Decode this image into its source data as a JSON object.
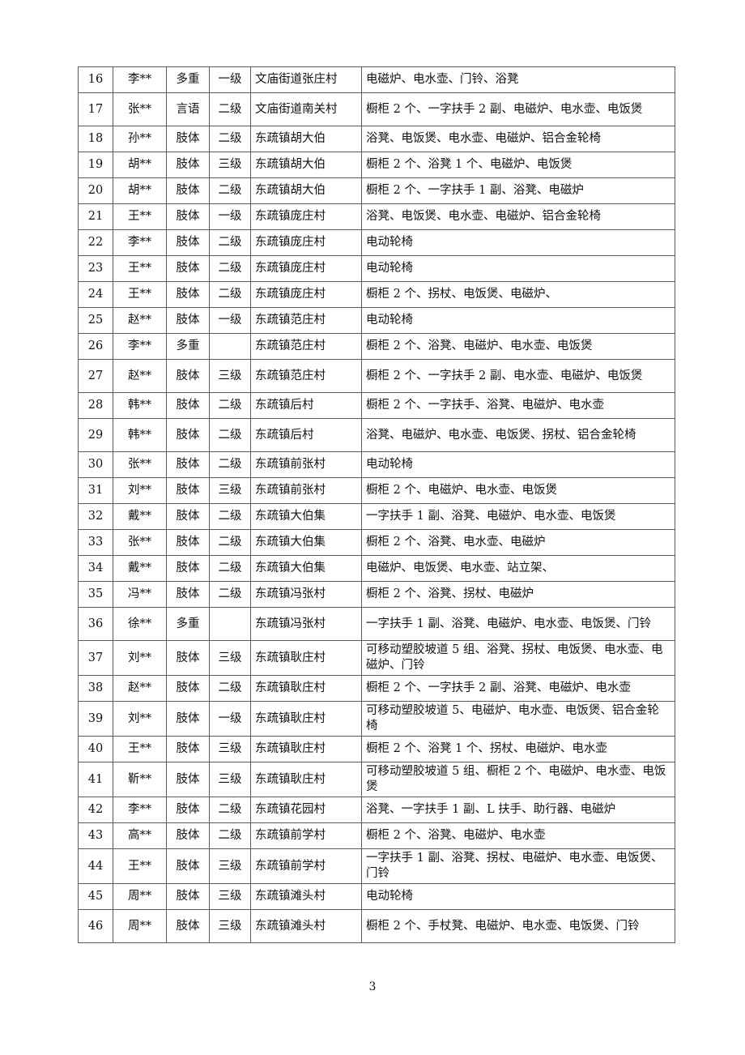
{
  "table": {
    "rows": [
      {
        "no": "16",
        "name": "李**",
        "type": "多重",
        "level": "一级",
        "address": "文庙街道张庄村",
        "items": "电磁炉、电水壶、门铃、浴凳"
      },
      {
        "no": "17",
        "name": "张**",
        "type": "言语",
        "level": "二级",
        "address": "文庙街道南关村",
        "items": "橱柜 2 个、一字扶手 2 副、电磁炉、电水壶、电饭煲"
      },
      {
        "no": "18",
        "name": "孙**",
        "type": "肢体",
        "level": "二级",
        "address": "东疏镇胡大伯",
        "items": "浴凳、电饭煲、电水壶、电磁炉、铝合金轮椅"
      },
      {
        "no": "19",
        "name": "胡**",
        "type": "肢体",
        "level": "三级",
        "address": "东疏镇胡大伯",
        "items": "橱柜 2 个、浴凳 1 个、电磁炉、电饭煲"
      },
      {
        "no": "20",
        "name": "胡**",
        "type": "肢体",
        "level": "二级",
        "address": "东疏镇胡大伯",
        "items": "橱柜 2 个、一字扶手 1 副、浴凳、电磁炉"
      },
      {
        "no": "21",
        "name": "王**",
        "type": "肢体",
        "level": "一级",
        "address": "东疏镇庞庄村",
        "items": "浴凳、电饭煲、电水壶、电磁炉、铝合金轮椅"
      },
      {
        "no": "22",
        "name": "李**",
        "type": "肢体",
        "level": "二级",
        "address": "东疏镇庞庄村",
        "items": "电动轮椅"
      },
      {
        "no": "23",
        "name": "王**",
        "type": "肢体",
        "level": "二级",
        "address": "东疏镇庞庄村",
        "items": "电动轮椅"
      },
      {
        "no": "24",
        "name": "王**",
        "type": "肢体",
        "level": "二级",
        "address": "东疏镇庞庄村",
        "items": "橱柜 2 个、拐杖、电饭煲、电磁炉、"
      },
      {
        "no": "25",
        "name": "赵**",
        "type": "肢体",
        "level": "一级",
        "address": "东疏镇范庄村",
        "items": "电动轮椅"
      },
      {
        "no": "26",
        "name": "李**",
        "type": "多重",
        "level": "",
        "address": "东疏镇范庄村",
        "items": "橱柜 2 个、浴凳、电磁炉、电水壶、电饭煲"
      },
      {
        "no": "27",
        "name": "赵**",
        "type": "肢体",
        "level": "三级",
        "address": "东疏镇范庄村",
        "items": "橱柜 2 个、一字扶手 2 副、电水壶、电磁炉、电饭煲"
      },
      {
        "no": "28",
        "name": "韩**",
        "type": "肢体",
        "level": "二级",
        "address": "东疏镇后村",
        "items": "橱柜 2 个、一字扶手、浴凳、电磁炉、电水壶"
      },
      {
        "no": "29",
        "name": "韩**",
        "type": "肢体",
        "level": "二级",
        "address": "东疏镇后村",
        "items": "浴凳、电磁炉、电水壶、电饭煲、拐杖、铝合金轮椅"
      },
      {
        "no": "30",
        "name": "张**",
        "type": "肢体",
        "level": "二级",
        "address": "东疏镇前张村",
        "items": "电动轮椅"
      },
      {
        "no": "31",
        "name": "刘**",
        "type": "肢体",
        "level": "三级",
        "address": "东疏镇前张村",
        "items": "橱柜 2 个、电磁炉、电水壶、电饭煲"
      },
      {
        "no": "32",
        "name": "戴**",
        "type": "肢体",
        "level": "二级",
        "address": "东疏镇大伯集",
        "items": "一字扶手 1 副、浴凳、电磁炉、电水壶、电饭煲"
      },
      {
        "no": "33",
        "name": "张**",
        "type": "肢体",
        "level": "二级",
        "address": "东疏镇大伯集",
        "items": "橱柜 2 个、浴凳、电水壶、电磁炉"
      },
      {
        "no": "34",
        "name": "戴**",
        "type": "肢体",
        "level": "二级",
        "address": "东疏镇大伯集",
        "items": "电磁炉、电饭煲、电水壶、站立架、"
      },
      {
        "no": "35",
        "name": "冯**",
        "type": "肢体",
        "level": "二级",
        "address": "东疏镇冯张村",
        "items": "橱柜 2 个、浴凳、拐杖、电磁炉"
      },
      {
        "no": "36",
        "name": "徐**",
        "type": "多重",
        "level": "",
        "address": "东疏镇冯张村",
        "items": "一字扶手 1 副、浴凳、电磁炉、电水壶、电饭煲、门铃"
      },
      {
        "no": "37",
        "name": "刘**",
        "type": "肢体",
        "level": "三级",
        "address": "东疏镇耿庄村",
        "items": "可移动塑胶坡道 5 组、浴凳、拐杖、电饭煲、电水壶、电磁炉、门铃"
      },
      {
        "no": "38",
        "name": "赵**",
        "type": "肢体",
        "level": "二级",
        "address": "东疏镇耿庄村",
        "items": "橱柜 2 个、一字扶手 2 副、浴凳、电磁炉、电水壶"
      },
      {
        "no": "39",
        "name": "刘**",
        "type": "肢体",
        "level": "一级",
        "address": "东疏镇耿庄村",
        "items": "可移动塑胶坡道 5、电磁炉、电水壶、电饭煲、铝合金轮椅"
      },
      {
        "no": "40",
        "name": "王**",
        "type": "肢体",
        "level": "三级",
        "address": "东疏镇耿庄村",
        "items": "橱柜 2 个、浴凳 1 个、拐杖、电磁炉、电水壶"
      },
      {
        "no": "41",
        "name": "靳**",
        "type": "肢体",
        "level": "三级",
        "address": "东疏镇耿庄村",
        "items": "可移动塑胶坡道 5 组、橱柜 2 个、电磁炉、电水壶、电饭煲"
      },
      {
        "no": "42",
        "name": "李**",
        "type": "肢体",
        "level": "二级",
        "address": "东疏镇花园村",
        "items": "浴凳、一字扶手 1 副、L 扶手、助行器、电磁炉"
      },
      {
        "no": "43",
        "name": "高**",
        "type": "肢体",
        "level": "二级",
        "address": "东疏镇前学村",
        "items": "橱柜 2 个、浴凳、电磁炉、电水壶"
      },
      {
        "no": "44",
        "name": "王**",
        "type": "肢体",
        "level": "三级",
        "address": "东疏镇前学村",
        "items": "一字扶手 1 副、浴凳、拐杖、电磁炉、电水壶、电饭煲、门铃"
      },
      {
        "no": "45",
        "name": "周**",
        "type": "肢体",
        "level": "三级",
        "address": "东疏镇滩头村",
        "items": "电动轮椅"
      },
      {
        "no": "46",
        "name": "周**",
        "type": "肢体",
        "level": "三级",
        "address": "东疏镇滩头村",
        "items": "橱柜 2 个、手杖凳、电磁炉、电水壶、电饭煲、门铃"
      }
    ]
  },
  "footer": {
    "page_number": "3"
  }
}
